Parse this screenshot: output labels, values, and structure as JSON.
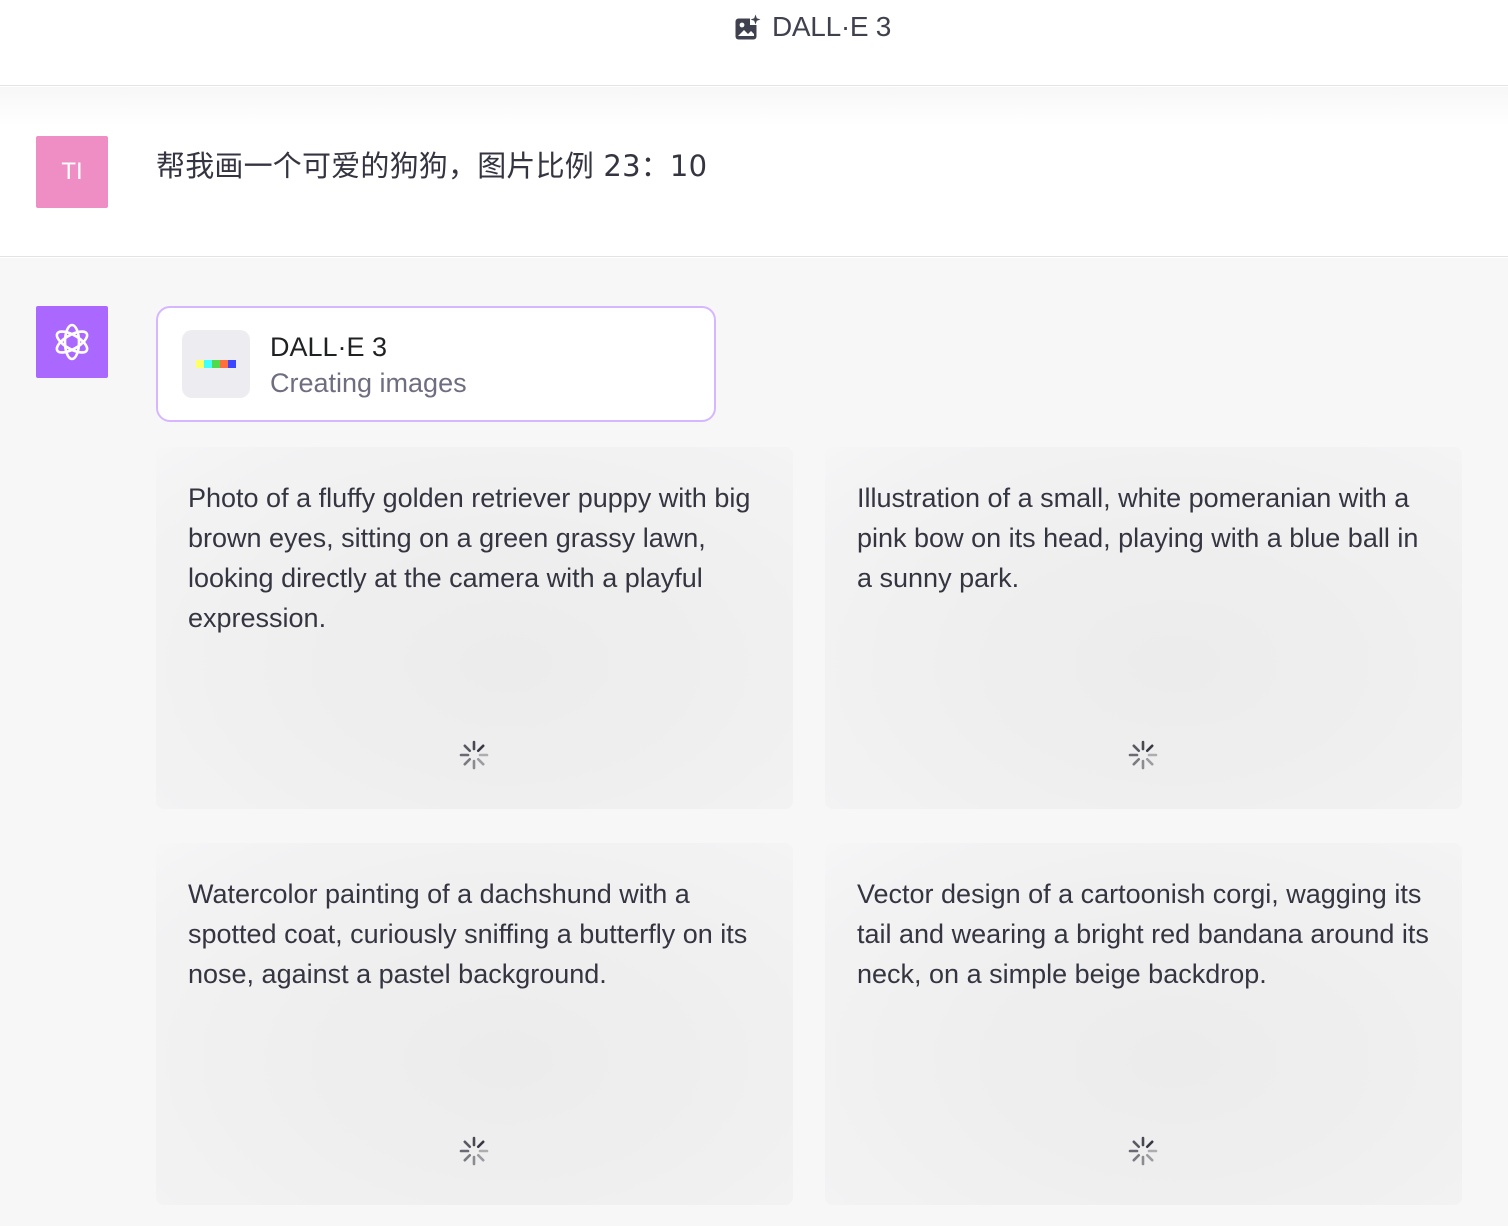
{
  "header": {
    "title": "DALL·E 3",
    "icon": "image-sparkle-icon"
  },
  "user_message": {
    "avatar_initials": "TI",
    "avatar_color": "#ee8ec4",
    "text": "帮我画一个可爱的狗狗，图片比例 23：10"
  },
  "assistant": {
    "avatar_icon": "openai-logo-icon",
    "avatar_color": "#ab68ff",
    "tool": {
      "name": "DALL·E 3",
      "status": "Creating images",
      "icon": "dalle-color-strip-icon",
      "strip_colors": [
        "#ffff66",
        "#42ffff",
        "#51da4c",
        "#ff6e3c",
        "#3c46ff"
      ]
    },
    "images": [
      {
        "prompt": "Photo of a fluffy golden retriever puppy with big brown eyes, sitting on a green grassy lawn, looking directly at the camera with a playful expression."
      },
      {
        "prompt": "Illustration of a small, white pomeranian with a pink bow on its head, playing with a blue ball in a sunny park."
      },
      {
        "prompt": "Watercolor painting of a dachshund with a spotted coat, curiously sniffing a butterfly on its nose, against a pastel background."
      },
      {
        "prompt": "Vector design of a cartoonish corgi, wagging its tail and wearing a bright red bandana around its neck, on a simple beige backdrop."
      }
    ]
  },
  "colors": {
    "accent_border": "#d6b7ff",
    "text": "#343541",
    "muted_text": "#6e6e80",
    "panel_bg": "#f7f7f8"
  }
}
